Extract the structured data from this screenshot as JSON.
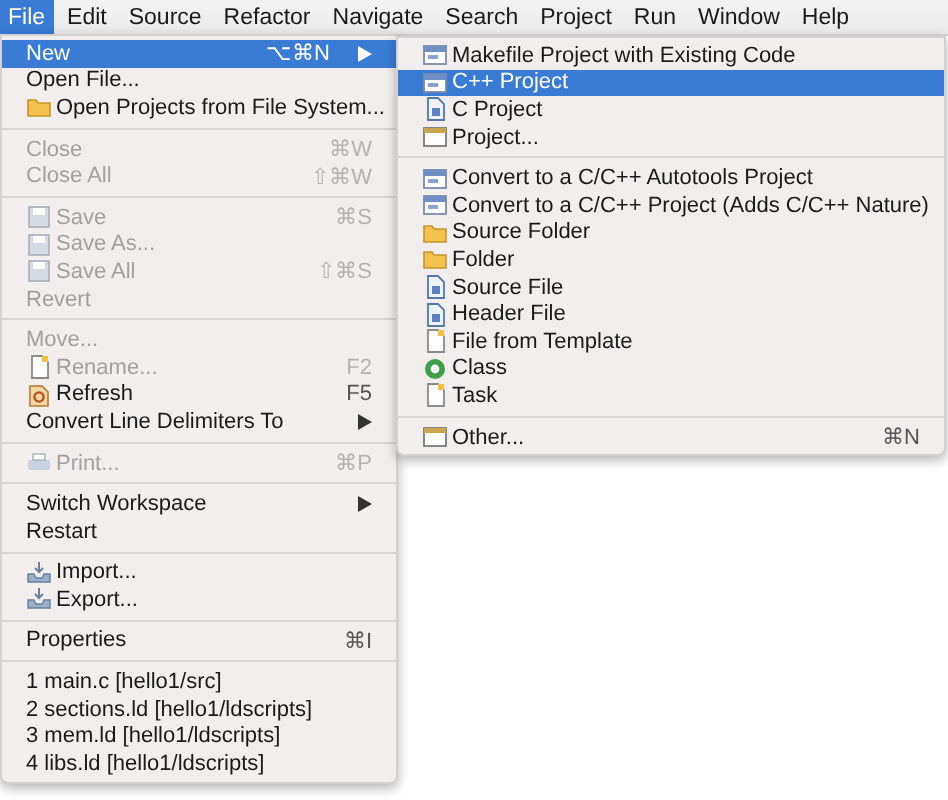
{
  "menu_bar": [
    {
      "label": "File",
      "selected": true
    },
    {
      "label": "Edit",
      "selected": false
    },
    {
      "label": "Source",
      "selected": false
    },
    {
      "label": "Refactor",
      "selected": false
    },
    {
      "label": "Navigate",
      "selected": false
    },
    {
      "label": "Search",
      "selected": false
    },
    {
      "label": "Project",
      "selected": false
    },
    {
      "label": "Run",
      "selected": false
    },
    {
      "label": "Window",
      "selected": false
    },
    {
      "label": "Help",
      "selected": false
    }
  ],
  "file_menu": {
    "groups": [
      [
        {
          "label": "New",
          "shortcut": "⌥⌘N",
          "submenu": true,
          "selected": true,
          "disabled": false
        },
        {
          "label": "Open File...",
          "selected": false,
          "disabled": false
        },
        {
          "label": "Open Projects from File System...",
          "selected": false,
          "disabled": false
        }
      ],
      [
        {
          "label": "Close",
          "shortcut": "⌘W",
          "selected": false,
          "disabled": true
        },
        {
          "label": "Close All",
          "shortcut": "⇧⌘W",
          "selected": false,
          "disabled": true
        }
      ],
      [
        {
          "label": "Save",
          "shortcut": "⌘S",
          "selected": false,
          "disabled": true
        },
        {
          "label": "Save As...",
          "selected": false,
          "disabled": true
        },
        {
          "label": "Save All",
          "shortcut": "⇧⌘S",
          "selected": false,
          "disabled": true
        },
        {
          "label": "Revert",
          "selected": false,
          "disabled": true
        }
      ],
      [
        {
          "label": "Move...",
          "selected": false,
          "disabled": true
        },
        {
          "label": "Rename...",
          "shortcut": "F2",
          "selected": false,
          "disabled": true
        },
        {
          "label": "Refresh",
          "shortcut": "F5",
          "selected": false,
          "disabled": false
        },
        {
          "label": "Convert Line Delimiters To",
          "submenu": true,
          "selected": false,
          "disabled": false
        }
      ],
      [
        {
          "label": "Print...",
          "shortcut": "⌘P",
          "selected": false,
          "disabled": true
        }
      ],
      [
        {
          "label": "Switch Workspace",
          "submenu": true,
          "selected": false,
          "disabled": false
        },
        {
          "label": "Restart",
          "selected": false,
          "disabled": false
        }
      ],
      [
        {
          "label": "Import...",
          "selected": false,
          "disabled": false
        },
        {
          "label": "Export...",
          "selected": false,
          "disabled": false
        }
      ],
      [
        {
          "label": "Properties",
          "shortcut": "⌘I",
          "selected": false,
          "disabled": false
        }
      ],
      [
        {
          "label": "1 main.c  [hello1/src]",
          "selected": false,
          "disabled": false
        },
        {
          "label": "2 sections.ld  [hello1/ldscripts]",
          "selected": false,
          "disabled": false
        },
        {
          "label": "3 mem.ld  [hello1/ldscripts]",
          "selected": false,
          "disabled": false
        },
        {
          "label": "4 libs.ld  [hello1/ldscripts]",
          "selected": false,
          "disabled": false
        }
      ]
    ]
  },
  "new_submenu": {
    "groups": [
      [
        {
          "label": "Makefile Project with Existing Code",
          "selected": false,
          "disabled": false
        },
        {
          "label": "C++ Project",
          "selected": true,
          "disabled": false
        },
        {
          "label": "C Project",
          "selected": false,
          "disabled": false
        },
        {
          "label": "Project...",
          "selected": false,
          "disabled": false
        }
      ],
      [
        {
          "label": "Convert to a C/C++ Autotools Project",
          "selected": false,
          "disabled": false
        },
        {
          "label": "Convert to a C/C++ Project (Adds C/C++ Nature)",
          "selected": false,
          "disabled": false
        },
        {
          "label": "Source Folder",
          "selected": false,
          "disabled": false
        },
        {
          "label": "Folder",
          "selected": false,
          "disabled": false
        },
        {
          "label": "Source File",
          "selected": false,
          "disabled": false
        },
        {
          "label": "Header File",
          "selected": false,
          "disabled": false
        },
        {
          "label": "File from Template",
          "selected": false,
          "disabled": false
        },
        {
          "label": "Class",
          "selected": false,
          "disabled": false
        },
        {
          "label": "Task",
          "selected": false,
          "disabled": false
        }
      ],
      [
        {
          "label": "Other...",
          "shortcut": "⌘N",
          "selected": false,
          "disabled": false
        }
      ]
    ]
  }
}
